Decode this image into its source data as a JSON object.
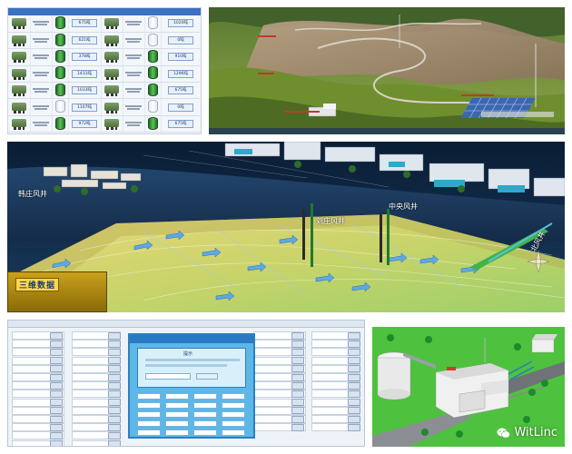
{
  "silo_panel": {
    "rows": [
      {
        "left_value": "675吨",
        "left_fill": "full",
        "right_value": "1020吨",
        "right_fill": "empty"
      },
      {
        "left_value": "621吨",
        "left_fill": "full",
        "right_value": "0吨",
        "right_fill": "empty"
      },
      {
        "left_value": "378吨",
        "left_fill": "full",
        "right_value": "910吨",
        "right_fill": "full"
      },
      {
        "left_value": "1431吨",
        "left_fill": "full",
        "right_value": "1296吨",
        "right_fill": "full"
      },
      {
        "left_value": "1033吨",
        "left_fill": "full",
        "right_value": "675吨",
        "right_fill": "full"
      },
      {
        "left_value": "1107吨",
        "left_fill": "empty",
        "right_value": "0吨",
        "right_fill": "empty"
      },
      {
        "left_value": "972吨",
        "left_fill": "full",
        "right_value": "675吨",
        "right_fill": "full"
      }
    ]
  },
  "ventilation_panel": {
    "fan_labels": {
      "hanzhuang": "韩庄风井",
      "zhongyang": "中央风井",
      "liuzhuang": "刘庄风井",
      "right_shaft": "北风井"
    },
    "sign_text": "三维数据"
  },
  "control_panel": {
    "dialog_title": "提示"
  },
  "watermark": {
    "text": "WitLinc",
    "icon": "wechat-icon"
  },
  "colors": {
    "table_header": "#3b72c2",
    "silo_green": "#3fa53b",
    "ventilation_bg": "#0d2440",
    "dialog_blue": "#5db7e8",
    "plant_grass": "#4ec23e"
  }
}
